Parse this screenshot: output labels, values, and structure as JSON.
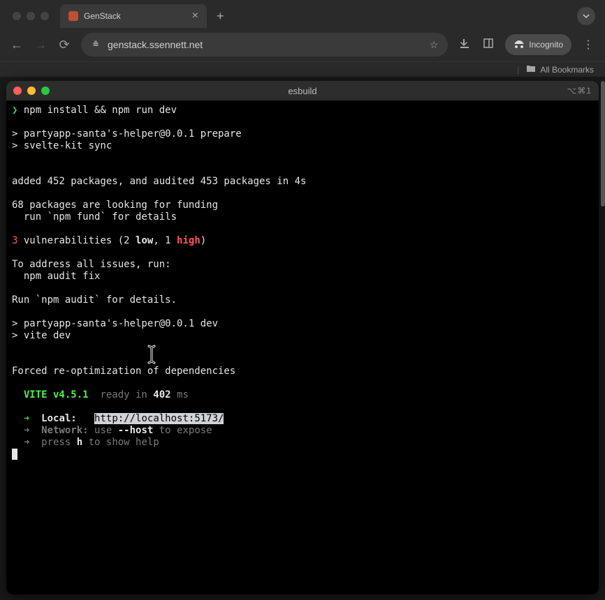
{
  "browser": {
    "tab_title": "GenStack",
    "url": "genstack.ssennett.net",
    "incognito_label": "Incognito",
    "all_bookmarks_label": "All Bookmarks"
  },
  "terminal": {
    "title": "esbuild",
    "tab_indicator": "⌥⌘1",
    "prompt_glyph": "❯",
    "command": "npm install && npm run dev",
    "lines": {
      "prep1": "> partyapp-santa's-helper@0.0.1 prepare",
      "prep2": "> svelte-kit sync",
      "added": "added 452 packages, and audited 453 packages in 4s",
      "fund1": "68 packages are looking for funding",
      "fund2": "  run `npm fund` for details",
      "vuln_count": "3",
      "vuln_mid": " vulnerabilities (2 ",
      "vuln_low": "low",
      "vuln_mid2": ", 1 ",
      "vuln_high": "high",
      "vuln_close": ")",
      "addr1": "To address all issues, run:",
      "addr2": "  npm audit fix",
      "audit": "Run `npm audit` for details.",
      "dev1": "> partyapp-santa's-helper@0.0.1 dev",
      "dev2": "> vite dev",
      "forced": "Forced re-optimization of dependencies",
      "vite_label": "  VITE v4.5.1",
      "ready_pre": "  ready in ",
      "ready_ms": "402",
      "ready_post": " ms",
      "arrow": "  ➜  ",
      "local_label": "Local:",
      "local_url": "http://localhost:5173/",
      "net_label": "Network:",
      "net_use": " use ",
      "net_flag": "--host",
      "net_expose": " to expose",
      "help_pre": "press ",
      "help_key": "h",
      "help_post": " to show help"
    }
  }
}
